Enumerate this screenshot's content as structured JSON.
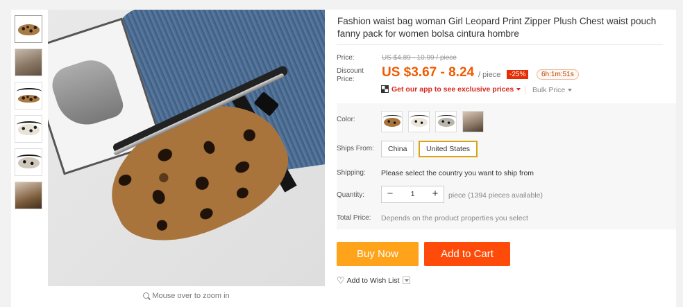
{
  "product": {
    "title": "Fashion waist bag woman Girl Leopard Print Zipper Plush Chest waist pouch fanny pack for women bolsa cintura hombre"
  },
  "gallery": {
    "zoom_hint": "Mouse over to zoom in",
    "thumbnails": [
      "leopard-bag",
      "model-wearing",
      "leopard-bag-strap",
      "white-leopard-bag",
      "leopard-bag-black-trim",
      "model-brown"
    ]
  },
  "price": {
    "price_label": "Price:",
    "original": "US $4.89 - 10.99 / piece",
    "discount_label": "Discount Price:",
    "current": "US $3.67 - 8.24",
    "unit": "/ piece",
    "discount_badge": "-25%",
    "timer": "6h:1m:51s",
    "app_promo": "Get our app to see exclusive prices",
    "bulk_price": "Bulk Price"
  },
  "options": {
    "color_label": "Color:",
    "ships_from_label": "Ships From:",
    "ships_from_options": [
      "China",
      "United States"
    ],
    "ships_from_selected": "United States",
    "shipping_label": "Shipping:",
    "shipping_value": "Please select the country you want to ship from",
    "quantity_label": "Quantity:",
    "quantity_value": "1",
    "available": "piece (1394 pieces available)",
    "total_label": "Total Price:",
    "total_value": "Depends on the product properties you select"
  },
  "actions": {
    "buy_now": "Buy Now",
    "add_to_cart": "Add to Cart",
    "wish_list": "Add to Wish List"
  },
  "colors": {
    "price": "#f05a00",
    "buy_now": "#ffa31a",
    "add_to_cart": "#ff4b0a",
    "badge": "#e62e04",
    "selected_border": "#d9a317"
  }
}
